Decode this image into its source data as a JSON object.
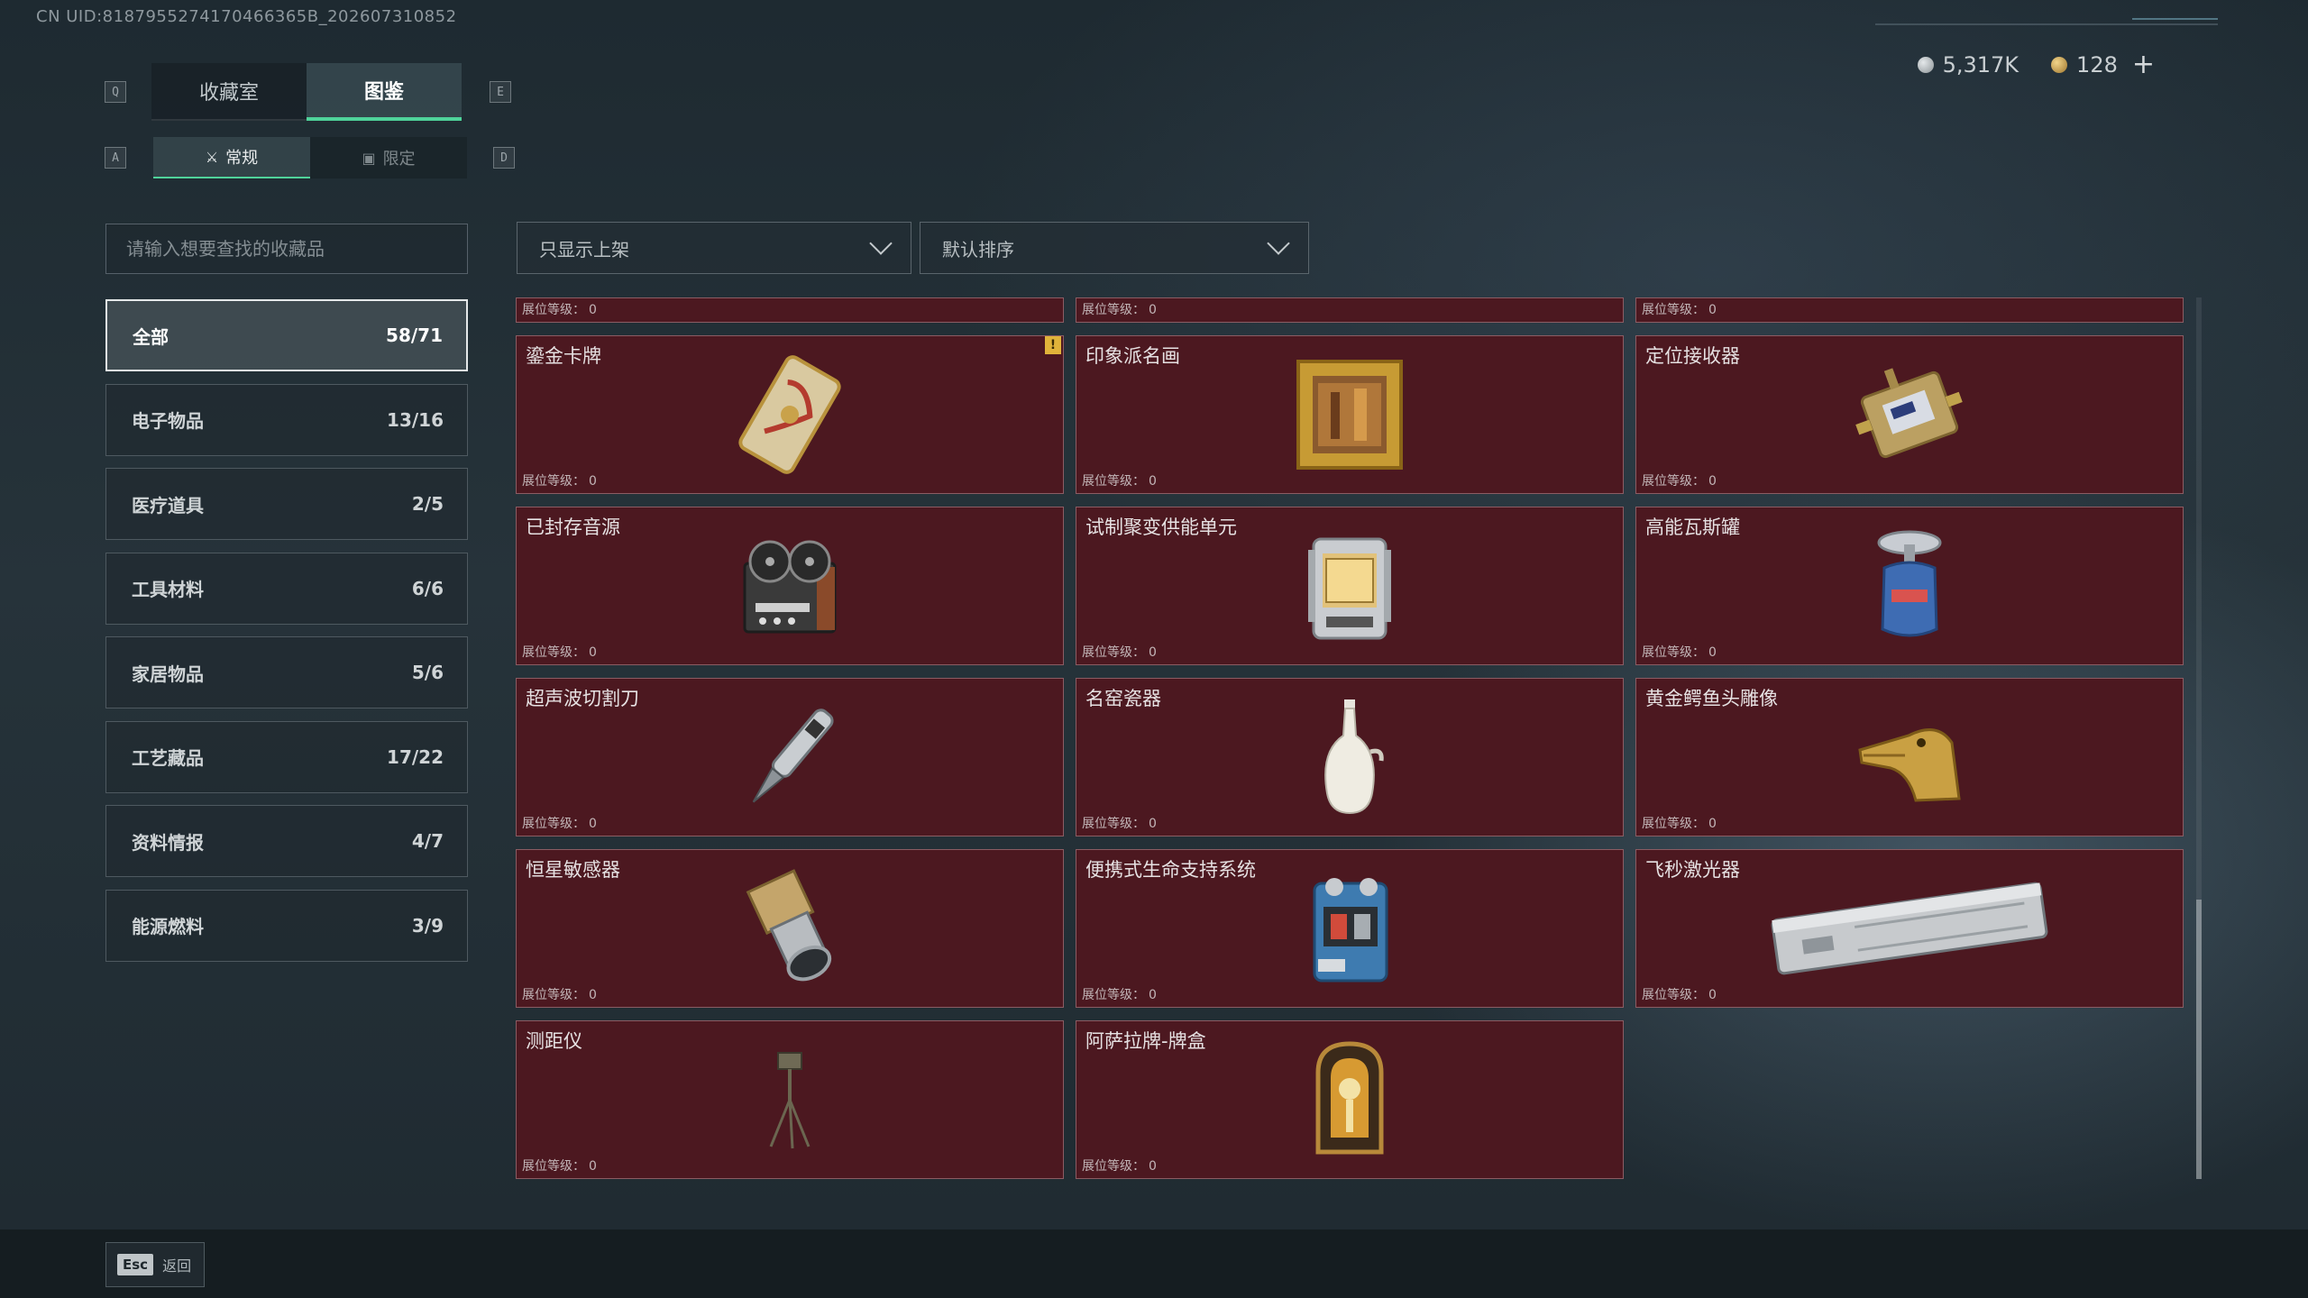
{
  "header": {
    "uid": "CN UID:8187955274170466365B_202607310852",
    "currency": [
      {
        "icon": "silver-coin-icon",
        "value": "5,317K"
      },
      {
        "icon": "gold-coin-icon",
        "value": "128"
      }
    ],
    "plus_label": "+"
  },
  "keys": {
    "prev_tab": "Q",
    "next_tab": "E",
    "prev_sub": "A",
    "next_sub": "D"
  },
  "tabs": [
    {
      "label": "收藏室",
      "active": false
    },
    {
      "label": "图鉴",
      "active": true
    }
  ],
  "subtabs": [
    {
      "label": "常规",
      "icon": "bottle-icon",
      "active": true
    },
    {
      "label": "限定",
      "icon": "image-icon",
      "active": false
    }
  ],
  "search": {
    "placeholder": "请输入想要查找的收藏品",
    "value": ""
  },
  "categories": [
    {
      "label": "全部",
      "count": "58/71",
      "active": true
    },
    {
      "label": "电子物品",
      "count": "13/16",
      "active": false
    },
    {
      "label": "医疗道具",
      "count": "2/5",
      "active": false
    },
    {
      "label": "工具材料",
      "count": "6/6",
      "active": false
    },
    {
      "label": "家居物品",
      "count": "5/6",
      "active": false
    },
    {
      "label": "工艺藏品",
      "count": "17/22",
      "active": false
    },
    {
      "label": "资料情报",
      "count": "4/7",
      "active": false
    },
    {
      "label": "能源燃料",
      "count": "3/9",
      "active": false
    }
  ],
  "filters": {
    "shelf_filter": "只显示上架",
    "sort": "默认排序"
  },
  "level_label": "展位等级：",
  "partial_row": [
    {
      "level": "0"
    },
    {
      "level": "0"
    },
    {
      "level": "0"
    }
  ],
  "items": [
    {
      "name": "鎏金卡牌",
      "level": "0",
      "icon": "gilded-card-icon",
      "new": true
    },
    {
      "name": "印象派名画",
      "level": "0",
      "icon": "framed-painting-icon",
      "new": false
    },
    {
      "name": "定位接收器",
      "level": "0",
      "icon": "locator-receiver-icon",
      "new": false
    },
    {
      "name": "已封存音源",
      "level": "0",
      "icon": "reel-tape-recorder-icon",
      "new": false
    },
    {
      "name": "试制聚变供能单元",
      "level": "0",
      "icon": "fusion-power-unit-icon",
      "new": false
    },
    {
      "name": "高能瓦斯罐",
      "level": "0",
      "icon": "gas-canister-icon",
      "new": false
    },
    {
      "name": "超声波切割刀",
      "level": "0",
      "icon": "ultrasonic-cutter-icon",
      "new": false
    },
    {
      "name": "名窑瓷器",
      "level": "0",
      "icon": "porcelain-vase-icon",
      "new": false
    },
    {
      "name": "黄金鳄鱼头雕像",
      "level": "0",
      "icon": "golden-crocodile-head-icon",
      "new": false
    },
    {
      "name": "恒星敏感器",
      "level": "0",
      "icon": "star-sensor-icon",
      "new": false
    },
    {
      "name": "便携式生命支持系统",
      "level": "0",
      "icon": "life-support-system-icon",
      "new": false
    },
    {
      "name": "飞秒激光器",
      "level": "0",
      "icon": "femtosecond-laser-icon",
      "new": false
    },
    {
      "name": "测距仪",
      "level": "0",
      "icon": "rangefinder-tripod-icon",
      "new": false
    },
    {
      "name": "阿萨拉牌-牌盒",
      "level": "0",
      "icon": "card-box-icon",
      "new": false
    }
  ],
  "badge_label": "!",
  "footer": {
    "esc_key": "Esc",
    "back_label": "返回"
  }
}
